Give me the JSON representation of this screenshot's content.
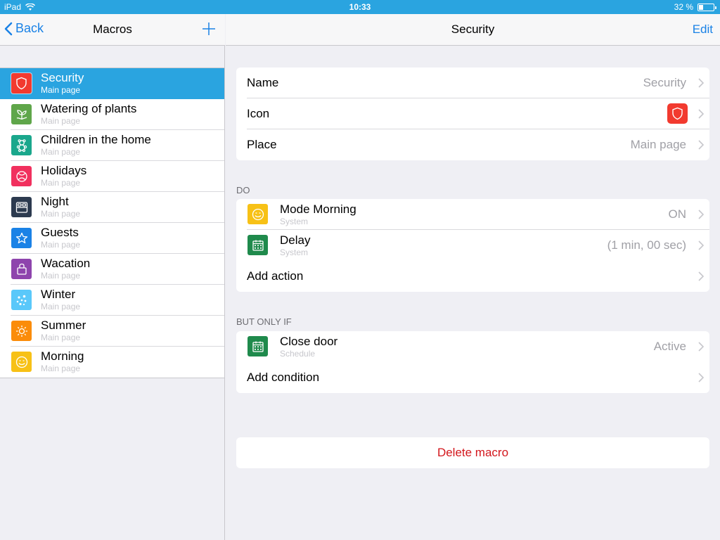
{
  "status_bar": {
    "device": "iPad",
    "time": "10:33",
    "battery": "32 %",
    "battery_level": 0.32,
    "bar_color": "#2aa4e0"
  },
  "left_nav": {
    "back_label": "Back",
    "title": "Macros",
    "add_icon": "plus-icon"
  },
  "macros": [
    {
      "name": "Security",
      "place": "Main page",
      "icon": "shield-icon",
      "color": "#f23a2f",
      "selected": true
    },
    {
      "name": "Watering of plants",
      "place": "Main page",
      "icon": "plant-icon",
      "color": "#5fa64a"
    },
    {
      "name": "Children in the home",
      "place": "Main page",
      "icon": "teddy-bear-icon",
      "color": "#1aa78c"
    },
    {
      "name": "Holidays",
      "place": "Main page",
      "icon": "ball-icon",
      "color": "#f1305e"
    },
    {
      "name": "Night",
      "place": "Main page",
      "icon": "bed-icon",
      "color": "#2c3a4f"
    },
    {
      "name": "Guests",
      "place": "Main page",
      "icon": "star-icon",
      "color": "#1a82e6"
    },
    {
      "name": "Wacation",
      "place": "Main page",
      "icon": "suitcase-icon",
      "color": "#8e44ad"
    },
    {
      "name": "Winter",
      "place": "Main page",
      "icon": "snowflake-icon",
      "color": "#5ac8fa"
    },
    {
      "name": "Summer",
      "place": "Main page",
      "icon": "sun-icon",
      "color": "#fb8c0a"
    },
    {
      "name": "Morning",
      "place": "Main page",
      "icon": "smile-icon",
      "color": "#f7c116"
    }
  ],
  "detail": {
    "title": "Security",
    "edit_label": "Edit",
    "properties": {
      "name_label": "Name",
      "name_value": "Security",
      "icon_label": "Icon",
      "icon_value": "shield-icon",
      "place_label": "Place",
      "place_value": "Main page"
    },
    "do_header": "DO",
    "actions": [
      {
        "title": "Mode Morning",
        "sub": "System",
        "value": "ON",
        "icon": "smile-icon",
        "color": "#f7c116"
      },
      {
        "title": "Delay",
        "sub": "System",
        "value": "(1 min, 00 sec)",
        "icon": "calendar-icon",
        "color": "#1f8a4c"
      }
    ],
    "add_action": "Add action",
    "condition_header": "BUT ONLY IF",
    "conditions": [
      {
        "title": "Close door",
        "sub": "Schedule",
        "value": "Active",
        "icon": "calendar-icon",
        "color": "#1f8a4c"
      }
    ],
    "add_condition": "Add condition",
    "delete_label": "Delete macro",
    "accent": "#1a82e6",
    "destructive": "#d3161c"
  }
}
